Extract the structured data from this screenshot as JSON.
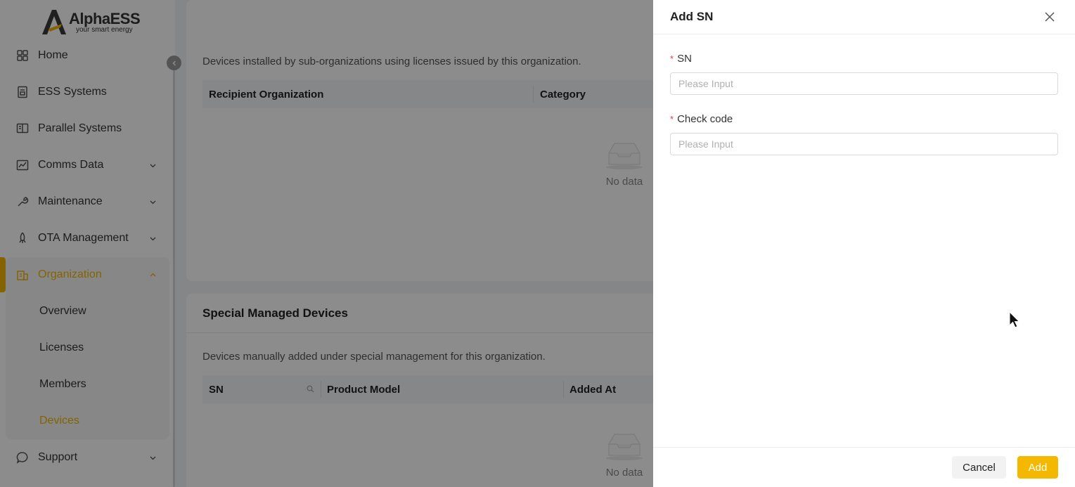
{
  "brand": {
    "name": "AlphaESS",
    "tagline": "your smart energy",
    "accent": "#f0b400"
  },
  "sidebar": {
    "items": [
      {
        "label": "Home",
        "icon": "home-grid-icon",
        "has_chevron": false
      },
      {
        "label": "ESS Systems",
        "icon": "ess-document-icon",
        "has_chevron": false
      },
      {
        "label": "Parallel Systems",
        "icon": "parallel-book-icon",
        "has_chevron": false
      },
      {
        "label": "Comms Data",
        "icon": "chart-line-icon",
        "has_chevron": true
      },
      {
        "label": "Maintenance",
        "icon": "wrench-icon",
        "has_chevron": true
      },
      {
        "label": "OTA Management",
        "icon": "rocket-icon",
        "has_chevron": true
      },
      {
        "label": "Organization",
        "icon": "building-icon",
        "has_chevron": true,
        "active": true
      },
      {
        "label": "Support",
        "icon": "chat-support-icon",
        "has_chevron": true
      }
    ],
    "org_sub_items": [
      {
        "label": "Overview"
      },
      {
        "label": "Licenses"
      },
      {
        "label": "Members"
      },
      {
        "label": "Devices",
        "active": true
      }
    ]
  },
  "main": {
    "licensed_devices": {
      "description": "Devices installed by sub-organizations using licenses issued by this organization.",
      "columns": [
        "Recipient Organization",
        "Category"
      ],
      "empty_text": "No data"
    },
    "special_devices": {
      "title": "Special Managed Devices",
      "description": "Devices manually added under special management for this organization.",
      "columns": [
        "SN",
        "Product Model",
        "Added At"
      ],
      "empty_text": "No data"
    }
  },
  "drawer": {
    "title": "Add SN",
    "fields": [
      {
        "label": "SN",
        "required": true,
        "placeholder": "Please Input",
        "value": ""
      },
      {
        "label": "Check code",
        "required": true,
        "placeholder": "Please Input",
        "value": ""
      }
    ],
    "cancel_label": "Cancel",
    "add_label": "Add"
  }
}
